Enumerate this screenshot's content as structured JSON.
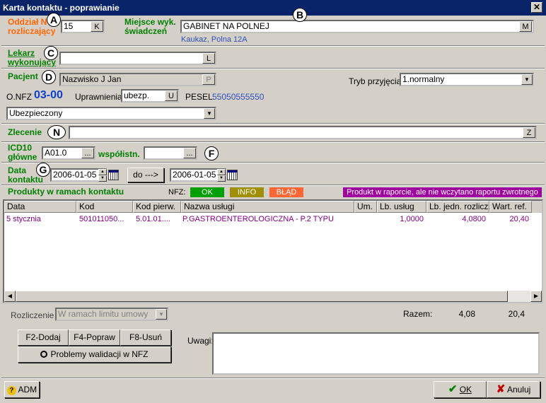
{
  "window": {
    "title": "Karta kontaktu - poprawianie",
    "close": "✕"
  },
  "markers": {
    "a": "A",
    "b": "B",
    "c": "C",
    "d": "D",
    "n": "N",
    "f": "F",
    "g": "G"
  },
  "oddzial": {
    "label1": "Oddział N",
    "label2": "rozliczający",
    "value": "15",
    "btn": "K"
  },
  "miejsce": {
    "label1": "Miejsce wyk.",
    "label2": "świadczeń",
    "value": "GABINET NA POLNEJ",
    "btn": "M",
    "address": "Kaukaz, Polna 12A"
  },
  "lekarz": {
    "label1": "Lekarz",
    "label2": "wykonujący",
    "value": "",
    "btn": "L"
  },
  "pacjent": {
    "label": "Pacjent",
    "value": "Nazwisko J Jan",
    "btn": "P",
    "tryb_label": "Tryb przyjęcia",
    "tryb_value": "1.normalny",
    "onfz_label": "O.NFZ",
    "onfz_value": "03-00",
    "upr_label": "Uprawnienia:",
    "upr_value": "ubezp.",
    "upr_btn": "U",
    "pesel_label": "PESEL",
    "pesel_value": "55050555550",
    "status_value": "Ubezpieczony"
  },
  "zlecenie": {
    "label": "Zlecenie",
    "value": "",
    "btn": "Z"
  },
  "icd": {
    "label1": "ICD10",
    "label2": "główne",
    "value": "A01.0",
    "btn": "...",
    "wsp_label": "współistn.",
    "wsp_value": "",
    "wsp_btn": "..."
  },
  "data_kontaktu": {
    "label1": "Data",
    "label2": "kontaktu",
    "from": "2006-01-05",
    "do_btn": "do --->",
    "to": "2006-01-05"
  },
  "produkty": {
    "title": "Produkty w ramach kontaktu",
    "nfz_label": "NFZ:",
    "badge_ok": "OK",
    "badge_info": "INFO",
    "badge_blad": "BŁĄD",
    "badge_raport": "Produkt w raporcie, ale nie wczytano raportu zwrotnego",
    "columns": [
      "Data",
      "Kod",
      "Kod pierw.",
      "Nazwa usługi",
      "Um.",
      "Lb. usług",
      "Lb. jedn. rozlicz.",
      "Wart. ref."
    ],
    "row": {
      "data": "5 stycznia",
      "kod": "501011050...",
      "kod_pierw": "5.01.01....",
      "nazwa": "P.GASTROENTEROLOGICZNA - P.2 TYPU",
      "um": "",
      "lb_uslug": "1,0000",
      "lb_jedn": "4,0800",
      "wart": "20,40"
    }
  },
  "rozliczenie": {
    "label": "Rozliczenie",
    "value": "W ramach limitu umowy",
    "razem_label": "Razem:",
    "razem_jedn": "4,08",
    "razem_wart": "20,4"
  },
  "buttons": {
    "dodaj": "F2-Dodaj",
    "popraw": "F4-Popraw",
    "usun": "F8-Usuń",
    "problemy": "Problemy walidacji w NFZ",
    "adm": "ADM",
    "ok": "OK",
    "anuluj": "Anuluj"
  },
  "uwagi": {
    "label": "Uwagi:",
    "value": ""
  },
  "colors": {
    "ok": "#00a000",
    "info": "#a09000",
    "blad": "#ff6633",
    "raport": "#a000a0"
  }
}
